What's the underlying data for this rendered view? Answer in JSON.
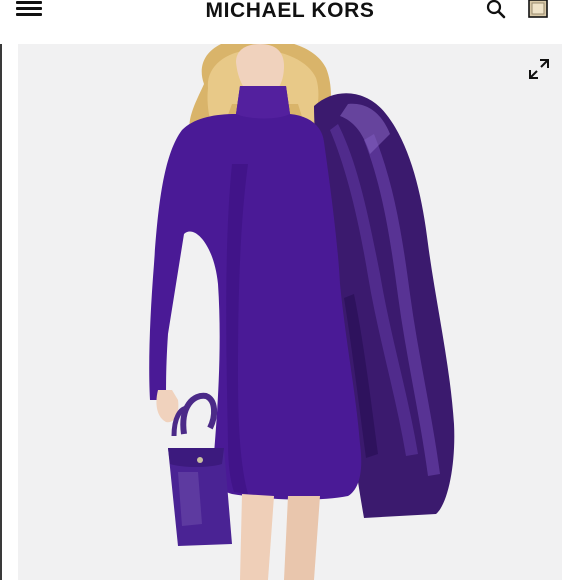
{
  "header": {
    "brand": "MICHAEL KORS",
    "menu_icon": "hamburger-menu-icon",
    "search_icon": "search-icon",
    "bag_icon": "shopping-bag-icon"
  },
  "product_image": {
    "expand_icon": "expand-icon"
  },
  "colors": {
    "dress": "#4a1a96",
    "fur": "#3b1a6e",
    "background": "#f1f1f2",
    "text": "#111111"
  }
}
